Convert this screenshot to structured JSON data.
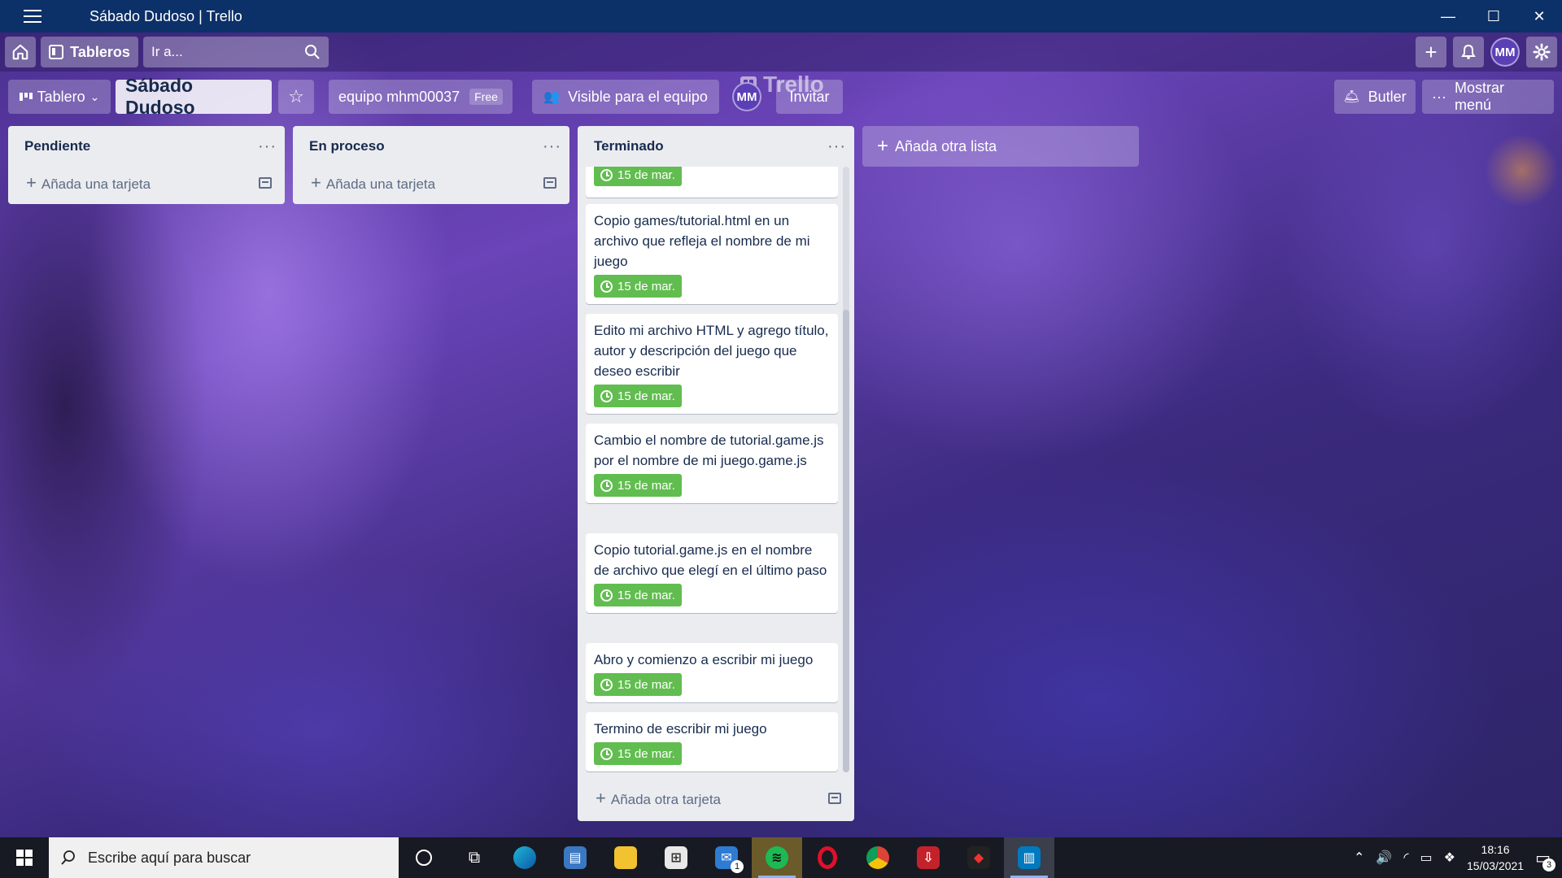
{
  "window": {
    "title": "Sábado Dudoso | Trello",
    "minimize": "—",
    "maximize": "☐",
    "close": "✕"
  },
  "header": {
    "boards_label": "Tableros",
    "search_placeholder": "Ir a...",
    "logo": "Trello",
    "avatar_initials": "MM"
  },
  "board": {
    "view_label": "Tablero",
    "title": "Sábado Dudoso",
    "team_label": "equipo mhm00037",
    "team_badge": "Free",
    "visibility_label": "Visible para el equipo",
    "member_initials": "MM",
    "invite_label": "Invitar",
    "butler_label": "Butler",
    "menu_label": "Mostrar menú"
  },
  "lists": [
    {
      "title": "Pendiente",
      "add_label": "Añada una tarjeta"
    },
    {
      "title": "En proceso",
      "add_label": "Añada una tarjeta"
    },
    {
      "title": "Terminado",
      "add_label": "Añada otra tarjeta",
      "cards": [
        {
          "text": "",
          "due": "15 de mar."
        },
        {
          "text": "Copio games/tutorial.html en un archivo que refleja el nombre de mi juego",
          "due": "15 de mar."
        },
        {
          "text": "Edito mi archivo HTML y agrego título, autor y descripción del juego que deseo escribir",
          "due": "15 de mar."
        },
        {
          "text": "Cambio el nombre de tutorial.game.js por el nombre de mi juego.game.js",
          "due": "15 de mar."
        },
        {
          "text": "Copio tutorial.game.js en el nombre de archivo que elegí en el último paso",
          "due": "15 de mar."
        },
        {
          "text": "Abro y comienzo a escribir mi juego",
          "due": "15 de mar."
        },
        {
          "text": "Termino de escribir mi juego",
          "due": "15 de mar."
        }
      ]
    }
  ],
  "add_list_label": "Añada otra lista",
  "taskbar": {
    "search_placeholder": "Escribe aquí para buscar",
    "mail_badge": "1",
    "time": "18:16",
    "date": "15/03/2021",
    "notification_count": "3"
  },
  "colors": {
    "titlebar": "#0c3068",
    "due_green": "#61bd4f",
    "list_bg": "#ebecf0"
  }
}
